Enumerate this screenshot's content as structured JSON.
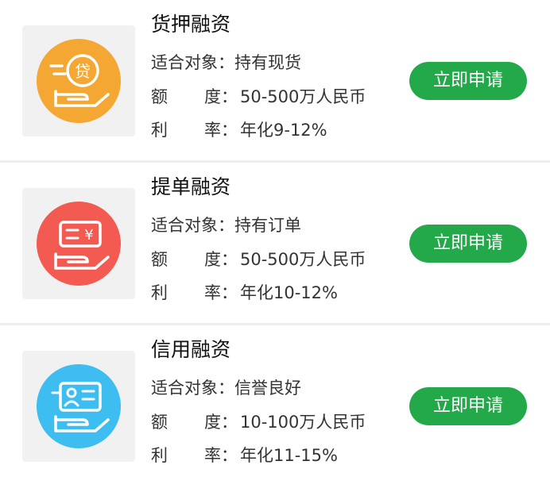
{
  "labels": {
    "target": "适合对象：",
    "amount_a": "额",
    "amount_b": "度",
    "rate_a": "利",
    "rate_b": "率",
    "colon": "："
  },
  "products": [
    {
      "title": "货押融资",
      "target": "持有现货",
      "amount": "50-500万人民币",
      "rate": "年化9-12%",
      "button": "立即申请",
      "icon": "cargo-loan-icon",
      "color": "#f5a733"
    },
    {
      "title": "提单融资",
      "target": "持有订单",
      "amount": "50-500万人民币",
      "rate": "年化10-12%",
      "button": "立即申请",
      "icon": "bill-loan-icon",
      "color": "#f25a52"
    },
    {
      "title": "信用融资",
      "target": "信誉良好",
      "amount": "10-100万人民币",
      "rate": "年化11-15%",
      "button": "立即申请",
      "icon": "credit-card-icon",
      "color": "#3ebdf0"
    }
  ],
  "colors": {
    "button": "#23a94a",
    "divider": "#eeeeee",
    "thumb_bg": "#f1f1f1"
  }
}
